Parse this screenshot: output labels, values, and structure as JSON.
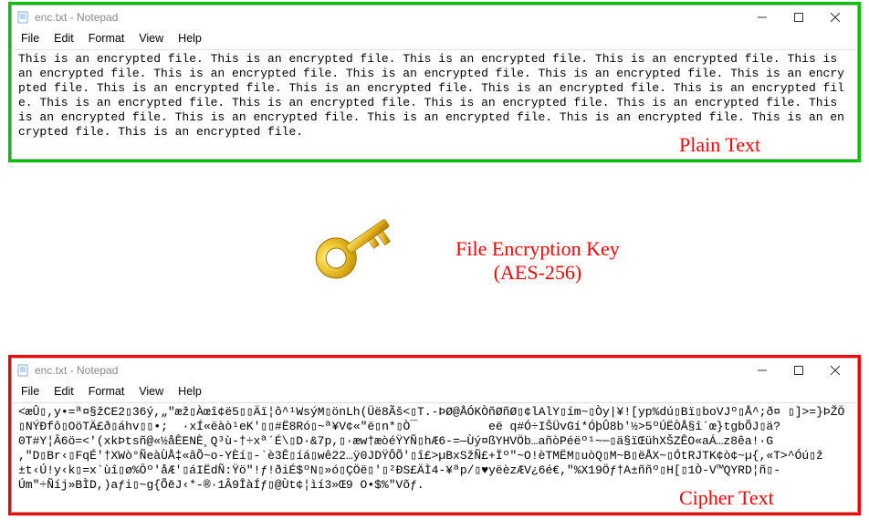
{
  "windows": {
    "plain": {
      "title": "enc.txt - Notepad",
      "menu": [
        "File",
        "Edit",
        "Format",
        "View",
        "Help"
      ],
      "content": "This is an encrypted file. This is an encrypted file. This is an encrypted file. This is an encrypted file. This is an encrypted file. This is an encrypted file. This is an encrypted file. This is an encrypted file. This is an encrypted file. This is an encrypted file. This is an encrypted file. This is an encrypted file. This is an encrypted file. This is an encrypted file. This is an encrypted file. This is an encrypted file. This is an encrypted file. This is an encrypted file. This is an encrypted file. This is an encrypted file. This is an encrypted file. This is an encrypted file. This is an encrypted file."
    },
    "cipher": {
      "title": "enc.txt - Notepad",
      "menu": [
        "File",
        "Edit",
        "Format",
        "View",
        "Help"
      ],
      "content": "<æÛ▯,y•=ª¤§žCE2▯36ý,„\"æž▯Àœî¢ë5▯▯Äï¦ô^¹WsýM▯önLh(Üë8Ãš<▯T.-ÞØ@ÅÓKÒñØñØ▯¢lAlY▯ím~▯Òy|¥![yp%dú▯Bï▯boVJº▯Å^;ð¤ ▯]>=}ÞŽÖ▯NÝĐfô▯OöTÄ£ð▯áhv▯▯•;  ·xÍ«ëàò¹eK'▯▯#Ë8Ró▯~ª¥V¢«\"ë▯n*▯Ò¯          eë q#Ó÷IŠÜvGí*ÓþÛ8b'½>5ºÚËÒÅ§î´œ}tgbÕJ▯ä?\n0T#Y¦Â6ö=<'(xkÞtsñ@«½åÊENÈ¸Q³ù-†÷xª´É\\▯D·&7p,▯·æw†æòéŸYÑ▯hÆ6-=—Ùý¤ßYHVÖb…añòPéëº¹~─▯ä§ïŒühXŠZÊO«aÁ…z8êa!·G\n,\"D▯Br‹▯FqÉ'†XWò°ÑeàÙÅ‡«âÕ~o-YÈí▯-`è3Ê▯íá▯wê22…ÿ0JDŸÔÕ'▯î£>µBxSžÑ£+Ïº\"~O!èTMËM▯uòQ▯M~B▯ëÅX~▯ÓtRJTK¢ò¢~µ{,«T>^Óú▯ž\n±t‹Ú!y‹k▯=x`ùî▯ø%Ōº'åÆ'▯áIËdÑ:Ÿö\"!ƒ!ðiÉ$ºN▯»ó▯ÇÖë▯'▯²ÐS£ÄÌ4-¥ªp/▯♥yëèzÆV¿6é€,\"%X19Öƒ†A±ññº▯H[▯1Ò-V™QYRD¦ñ▯-\nÚm\"÷Ñíj»BÌD,)aƒi▯~g{ÕēJ‹*-®·1Â9ÎàÍƒ▯@Ùt¢¦ìí3»Œ9 O•$%\"Võƒ."
    }
  },
  "labels": {
    "plain_text": "Plain Text",
    "cipher_text": "Cipher Text",
    "file_encryption_key_line1": "File Encryption Key",
    "file_encryption_key_line2": "(AES-256)"
  },
  "icons": {
    "notepad": "notepad-icon",
    "minimize": "minimize-icon",
    "maximize": "maximize-icon",
    "close": "close-icon",
    "key": "gold-key-icon"
  },
  "colors": {
    "plain_border": "#00c400",
    "cipher_border": "#ff0000",
    "label": "#ff0000"
  }
}
